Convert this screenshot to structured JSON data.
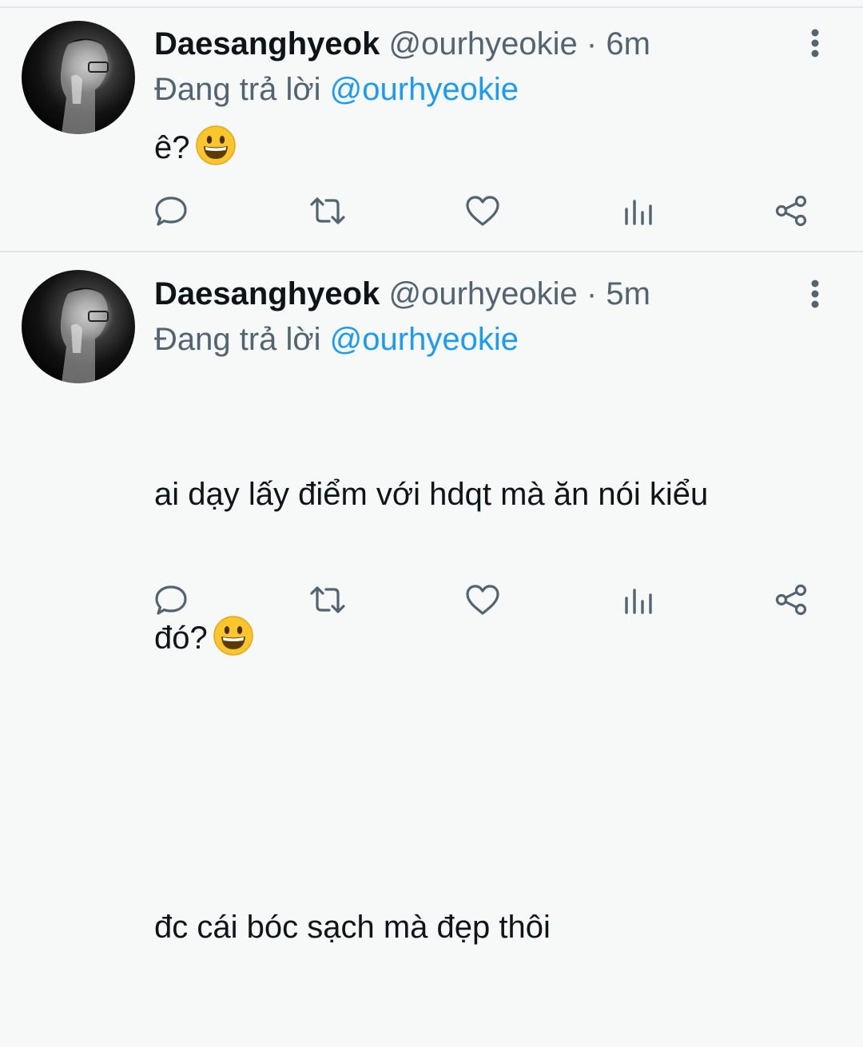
{
  "tweets": [
    {
      "display_name": "Daesanghyeok",
      "handle": "@ourhyeokie",
      "separator": "·",
      "time": "6m",
      "replying_prefix": "Đang trả lời",
      "replying_to": "@ourhyeokie",
      "text": "ê?",
      "has_emoji": true,
      "emoji": "grinning-face"
    },
    {
      "display_name": "Daesanghyeok",
      "handle": "@ourhyeokie",
      "separator": "·",
      "time": "5m",
      "replying_prefix": "Đang trả lời",
      "replying_to": "@ourhyeokie",
      "text_line1": "ai dạy lấy điểm với hdqt mà ăn nói kiểu",
      "text_line2": "đó?",
      "text_line3": "đc cái bóc sạch mà đẹp thôi",
      "has_emoji": true,
      "emoji": "grinning-face"
    }
  ],
  "actions": [
    "reply-icon",
    "retweet-icon",
    "like-icon",
    "analytics-icon",
    "share-icon"
  ],
  "colors": {
    "text": "#0f1419",
    "secondary": "#536471",
    "mention": "#1d9bf0",
    "background": "#f7f9f9",
    "divider": "#e2e6e9"
  }
}
